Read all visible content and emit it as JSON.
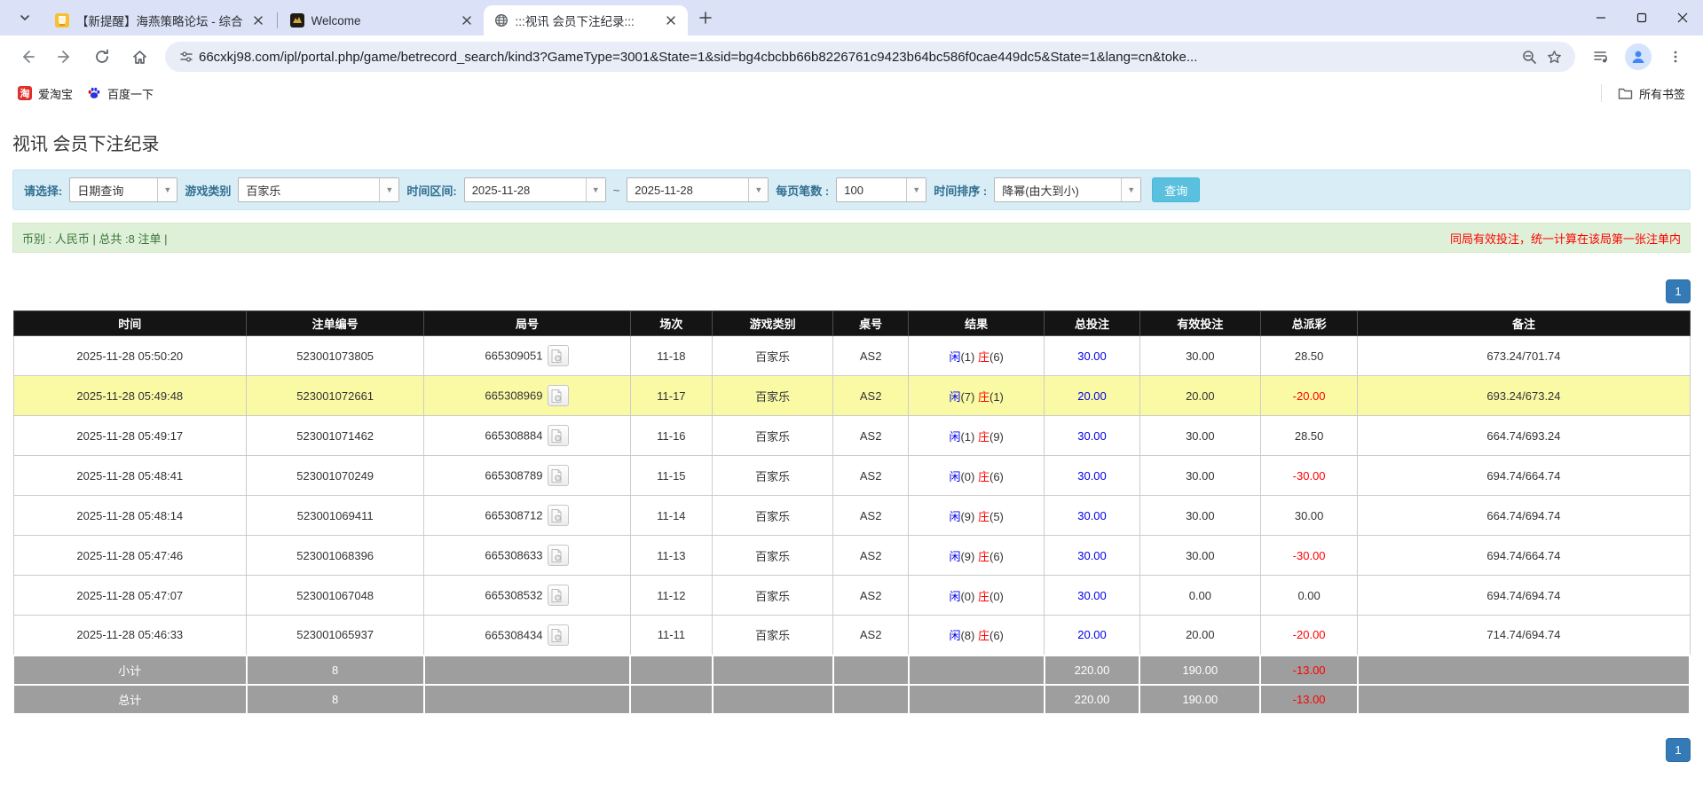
{
  "browser": {
    "tabs": [
      {
        "title": "【新提醒】海燕策略论坛 - 综合",
        "active": false
      },
      {
        "title": "Welcome",
        "active": false
      },
      {
        "title": ":::视讯 会员下注纪录:::",
        "active": true
      }
    ],
    "url": "66cxkj98.com/ipl/portal.php/game/betrecord_search/kind3?GameType=3001&State=1&sid=bg4cbcbb66b8226761c9423b64bc586f0cae449dc5&State=1&lang=cn&toke...",
    "bookmarks": {
      "taobao": "爱淘宝",
      "taobao_icon_char": "淘",
      "baidu": "百度一下",
      "all_bookmarks": "所有书签"
    }
  },
  "page": {
    "title": "视讯 会员下注纪录",
    "filter": {
      "select_label": "请选择:",
      "select_value": "日期查询",
      "game_type_label": "游戏类别",
      "game_type_value": "百家乐",
      "date_range_label": "时间区间:",
      "date_from": "2025-11-28",
      "tilde": "~",
      "date_to": "2025-11-28",
      "page_size_label": "每页笔数 :",
      "page_size_value": "100",
      "sort_label": "时间排序 :",
      "sort_value": "降幂(由大到小)",
      "search_button": "查询"
    },
    "info_bar": {
      "left": "币别 : 人民币 | 总共 :8 注单 |",
      "right": "同局有效投注，统一计算在该局第一张注单内"
    },
    "pagination": {
      "page": "1"
    },
    "table": {
      "headers": [
        "时间",
        "注单编号",
        "局号",
        "场次",
        "游戏类别",
        "桌号",
        "结果",
        "总投注",
        "有效投注",
        "总派彩",
        "备注"
      ],
      "result_labels": {
        "player": "闲",
        "banker": "庄"
      },
      "rows": [
        {
          "time": "2025-11-28 05:50:20",
          "bet_id": "523001073805",
          "round": "665309051",
          "session": "11-18",
          "game": "百家乐",
          "table_no": "AS2",
          "player": "1",
          "banker": "6",
          "total_bet": "30.00",
          "valid_bet": "30.00",
          "payout": "28.50",
          "remark": "673.24/701.74",
          "highlight": false
        },
        {
          "time": "2025-11-28 05:49:48",
          "bet_id": "523001072661",
          "round": "665308969",
          "session": "11-17",
          "game": "百家乐",
          "table_no": "AS2",
          "player": "7",
          "banker": "1",
          "total_bet": "20.00",
          "valid_bet": "20.00",
          "payout": "-20.00",
          "remark": "693.24/673.24",
          "highlight": true
        },
        {
          "time": "2025-11-28 05:49:17",
          "bet_id": "523001071462",
          "round": "665308884",
          "session": "11-16",
          "game": "百家乐",
          "table_no": "AS2",
          "player": "1",
          "banker": "9",
          "total_bet": "30.00",
          "valid_bet": "30.00",
          "payout": "28.50",
          "remark": "664.74/693.24",
          "highlight": false
        },
        {
          "time": "2025-11-28 05:48:41",
          "bet_id": "523001070249",
          "round": "665308789",
          "session": "11-15",
          "game": "百家乐",
          "table_no": "AS2",
          "player": "0",
          "banker": "6",
          "total_bet": "30.00",
          "valid_bet": "30.00",
          "payout": "-30.00",
          "remark": "694.74/664.74",
          "highlight": false
        },
        {
          "time": "2025-11-28 05:48:14",
          "bet_id": "523001069411",
          "round": "665308712",
          "session": "11-14",
          "game": "百家乐",
          "table_no": "AS2",
          "player": "9",
          "banker": "5",
          "total_bet": "30.00",
          "valid_bet": "30.00",
          "payout": "30.00",
          "remark": "664.74/694.74",
          "highlight": false
        },
        {
          "time": "2025-11-28 05:47:46",
          "bet_id": "523001068396",
          "round": "665308633",
          "session": "11-13",
          "game": "百家乐",
          "table_no": "AS2",
          "player": "9",
          "banker": "6",
          "total_bet": "30.00",
          "valid_bet": "30.00",
          "payout": "-30.00",
          "remark": "694.74/664.74",
          "highlight": false
        },
        {
          "time": "2025-11-28 05:47:07",
          "bet_id": "523001067048",
          "round": "665308532",
          "session": "11-12",
          "game": "百家乐",
          "table_no": "AS2",
          "player": "0",
          "banker": "0",
          "total_bet": "30.00",
          "valid_bet": "0.00",
          "payout": "0.00",
          "remark": "694.74/694.74",
          "highlight": false
        },
        {
          "time": "2025-11-28 05:46:33",
          "bet_id": "523001065937",
          "round": "665308434",
          "session": "11-11",
          "game": "百家乐",
          "table_no": "AS2",
          "player": "8",
          "banker": "6",
          "total_bet": "20.00",
          "valid_bet": "20.00",
          "payout": "-20.00",
          "remark": "714.74/694.74",
          "highlight": false
        }
      ],
      "subtotal": {
        "label": "小计",
        "count": "8",
        "total_bet": "220.00",
        "valid_bet": "190.00",
        "payout": "-13.00"
      },
      "total": {
        "label": "总计",
        "count": "8",
        "total_bet": "220.00",
        "valid_bet": "190.00",
        "payout": "-13.00"
      }
    }
  }
}
